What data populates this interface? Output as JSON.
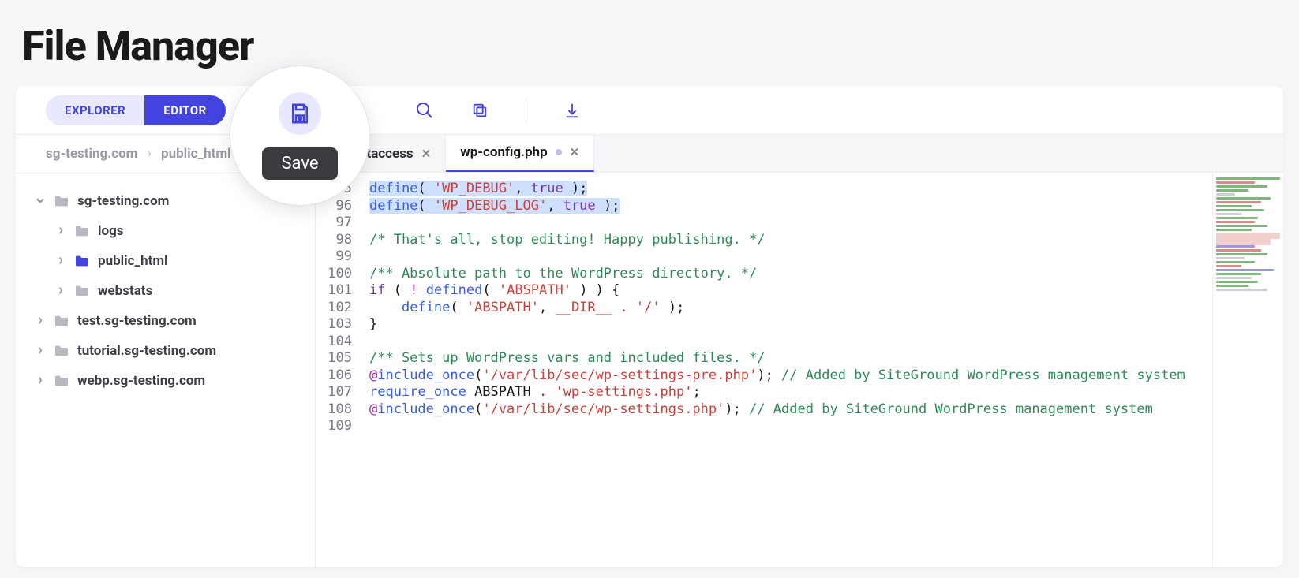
{
  "page_title": "File Manager",
  "mode": {
    "explorer": "EXPLORER",
    "editor": "EDITOR"
  },
  "callout": {
    "label": "Save"
  },
  "breadcrumb": {
    "root": "sg-testing.com",
    "path": "public_html"
  },
  "tree": {
    "root": "sg-testing.com",
    "children": [
      {
        "label": "logs",
        "color": "grey"
      },
      {
        "label": "public_html",
        "color": "blue"
      },
      {
        "label": "webstats",
        "color": "grey"
      }
    ],
    "siblings": [
      "test.sg-testing.com",
      "tutorial.sg-testing.com",
      "webp.sg-testing.com"
    ]
  },
  "tabs": [
    {
      "label": ".htaccess",
      "active": false
    },
    {
      "label": "wp-config.php",
      "active": true,
      "dirty": true
    }
  ],
  "line_start": 95,
  "code_lines": [
    {
      "n": 95,
      "hl": true,
      "html": "<span class='tok-fn'>define</span>( <span class='tok-str'>'WP_DEBUG'</span>, <span class='tok-kw'>true</span> );"
    },
    {
      "n": 96,
      "hl": true,
      "html": "<span class='tok-fn'>define</span>( <span class='tok-str'>'WP_DEBUG_LOG'</span>, <span class='tok-kw'>true</span> );"
    },
    {
      "n": 97,
      "html": ""
    },
    {
      "n": 98,
      "html": "<span class='tok-cmt'>/* That's all, stop editing! Happy publishing. */</span>"
    },
    {
      "n": 99,
      "html": ""
    },
    {
      "n": 100,
      "html": "<span class='tok-cmt'>/** Absolute path to the WordPress directory. */</span>"
    },
    {
      "n": 101,
      "html": "<span class='tok-kw'>if</span> ( <span class='tok-op'>!</span> <span class='tok-fn'>defined</span>( <span class='tok-str'>'ABSPATH'</span> ) ) {"
    },
    {
      "n": 102,
      "html": "    <span class='tok-fn'>define</span>( <span class='tok-str'>'ABSPATH'</span>, <span class='tok-const'>__DIR__</span> <span class='tok-op'>.</span> <span class='tok-str'>'/'</span> );"
    },
    {
      "n": 103,
      "html": "}"
    },
    {
      "n": 104,
      "html": ""
    },
    {
      "n": 105,
      "html": "<span class='tok-cmt'>/** Sets up WordPress vars and included files. */</span>"
    },
    {
      "n": 106,
      "html": "<span class='tok-op'>@</span><span class='tok-fn'>include_once</span>(<span class='tok-str'>'/var/lib/sec/wp-settings-pre.php'</span>); <span class='tok-cmt'>// Added by SiteGround WordPress management system</span>"
    },
    {
      "n": 107,
      "html": "<span class='tok-fn'>require_once</span> ABSPATH <span class='tok-op'>.</span> <span class='tok-str'>'wp-settings.php'</span>;"
    },
    {
      "n": 108,
      "html": "<span class='tok-op'>@</span><span class='tok-fn'>include_once</span>(<span class='tok-str'>'/var/lib/sec/wp-settings.php'</span>); <span class='tok-cmt'>// Added by SiteGround WordPress management system</span>"
    },
    {
      "n": 109,
      "html": ""
    }
  ]
}
